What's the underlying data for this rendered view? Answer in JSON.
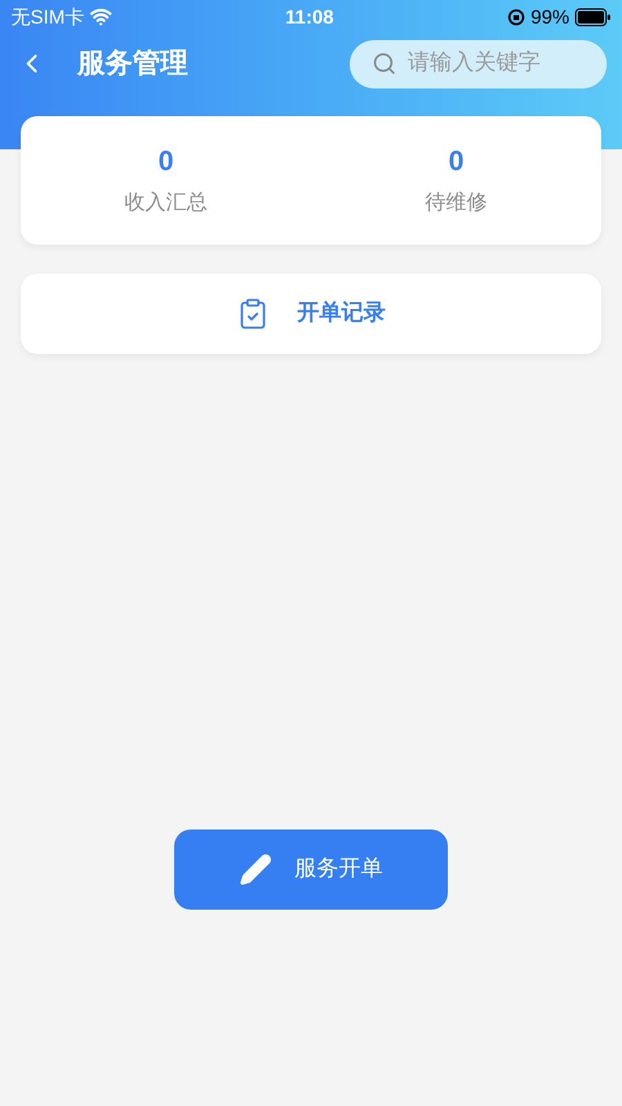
{
  "status_bar": {
    "carrier": "无SIM卡",
    "time": "11:08",
    "battery": "99%"
  },
  "nav": {
    "title": "服务管理",
    "search": {
      "placeholder": "请输入关键字"
    }
  },
  "stats": [
    {
      "value": "0",
      "label": "收入汇总"
    },
    {
      "value": "0",
      "label": "待维修"
    }
  ],
  "record_link": {
    "label": "开单记录"
  },
  "primary_button": {
    "label": "服务开单"
  }
}
